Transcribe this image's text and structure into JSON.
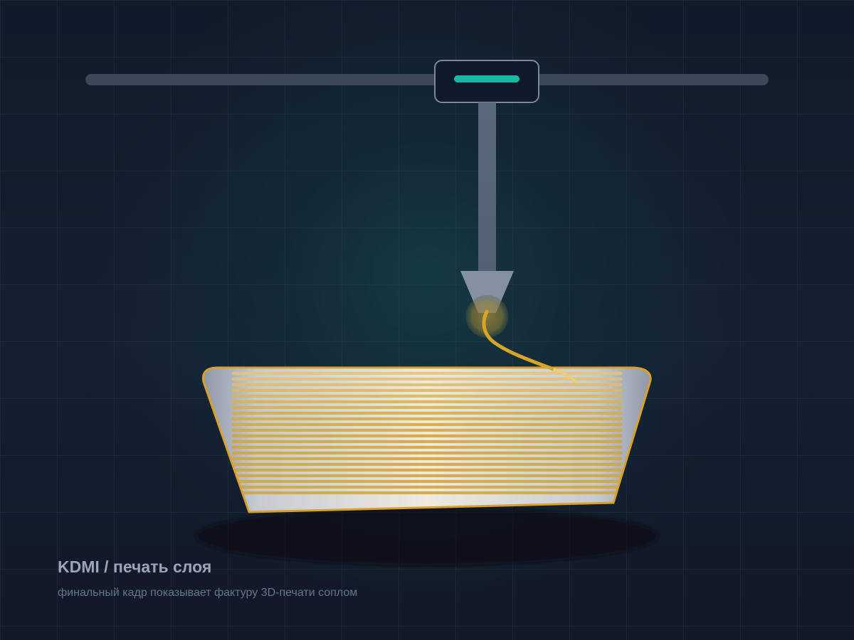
{
  "caption": {
    "title": "KDMI / печать слоя",
    "subtitle": "финальный кадр показывает фактуру 3D-печати соплом"
  },
  "colors": {
    "background": "#111a29",
    "grid": "#2b3646",
    "gantry": "#3b4758",
    "carriage_fill": "#111a2a",
    "carriage_border": "#7c8798",
    "status_accent": "#19b8a4",
    "extruder": "#5f6e82",
    "nozzle": "#8391a3",
    "filament": "#d6a626",
    "print_fill": "#bfc5cc",
    "print_outline": "#d9a12b",
    "shadow": "#0b1119"
  },
  "icons": {
    "gantry_rail": "horizontal-rail",
    "carriage": "printer-carriage",
    "nozzle": "downward-nozzle",
    "filament": "curved-filament",
    "print_object": "layered-print-object"
  }
}
